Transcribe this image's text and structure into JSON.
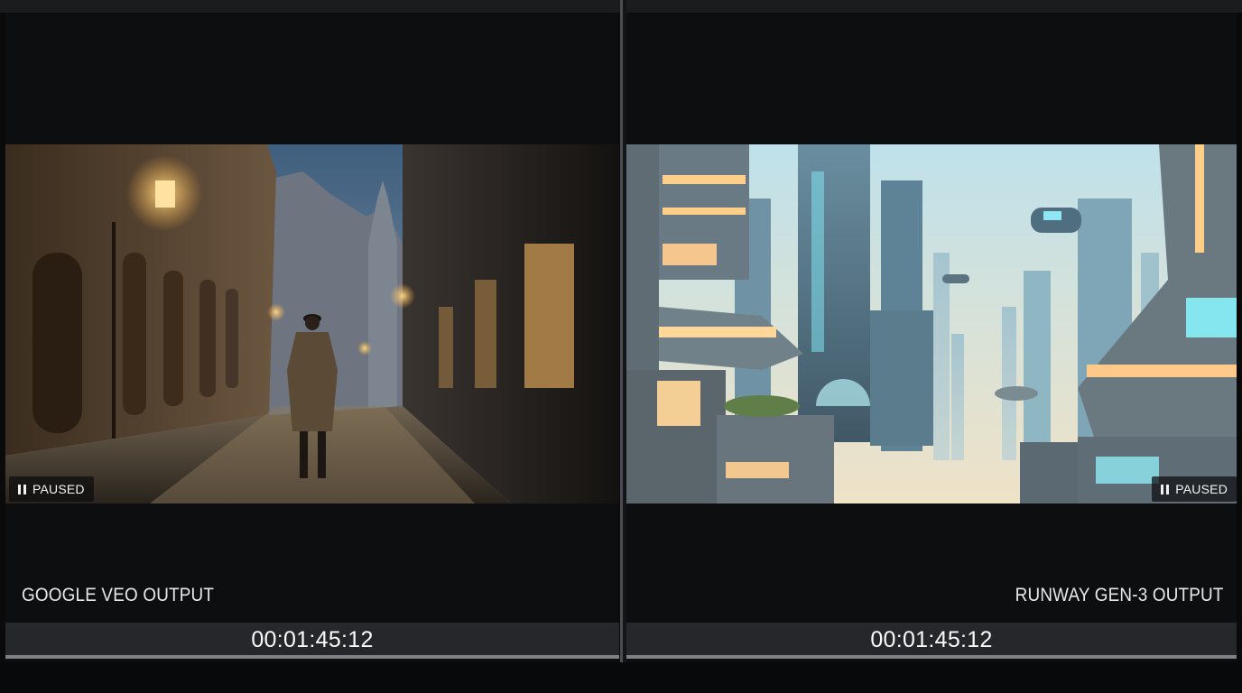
{
  "left_player": {
    "status": "PAUSED",
    "label": "GOOGLE VEO OUTPUT",
    "timecode": "00:01:45:12",
    "pause_icon": "pause-icon"
  },
  "right_player": {
    "status": "PAUSED",
    "label": "RUNWAY GEN-3 OUTPUT",
    "timecode": "00:01:45:12",
    "pause_icon": "pause-icon"
  },
  "colors": {
    "background": "#0a0a0b",
    "panel": "#0d0e10",
    "timecode_bar": "#25272a",
    "divider": "#4a4d52",
    "text": "#ffffff"
  }
}
